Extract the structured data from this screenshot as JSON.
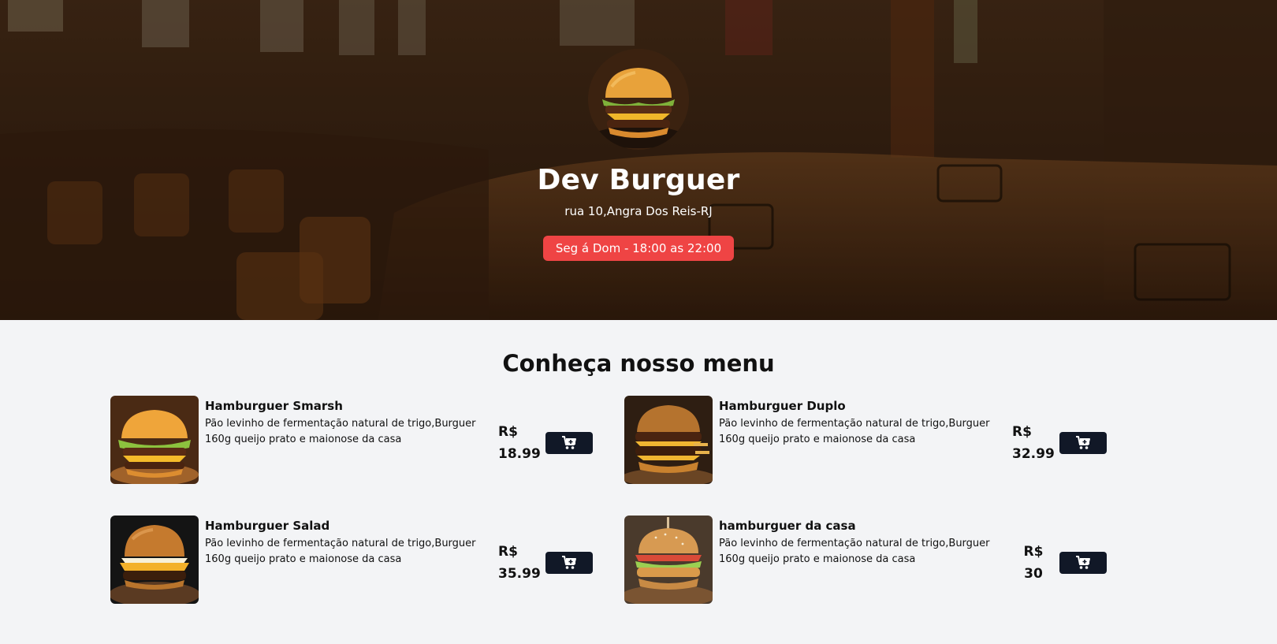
{
  "header": {
    "name": "Dev Burguer",
    "address": "rua 10,Angra Dos Reis-RJ",
    "hours": "Seg á Dom - 18:00 as 22:00",
    "hours_badge_color": "#ef4444"
  },
  "menu": {
    "title": "Conheça nosso menu",
    "items": [
      {
        "name": "Hamburguer Smarsh",
        "description": "Pão levinho de fermentação natural de trigo,Burguer 160g queijo prato e maionose da casa",
        "currency": "R$",
        "price": "18.99",
        "icon": "cart-plus-icon"
      },
      {
        "name": "Hamburguer Duplo",
        "description": "Pão levinho de fermentação natural de trigo,Burguer 160g queijo prato e maionose da casa",
        "currency": "R$",
        "price": "32.99",
        "icon": "cart-plus-icon"
      },
      {
        "name": "Hamburguer Salad",
        "description": "Pão levinho de fermentação natural de trigo,Burguer 160g queijo prato e maionose da casa",
        "currency": "R$",
        "price": "35.99",
        "icon": "cart-plus-icon"
      },
      {
        "name": "hamburguer da casa",
        "description": "Pão levinho de fermentação natural de trigo,Burguer 160g queijo prato e maionose da casa",
        "currency": "R$",
        "price": "30",
        "icon": "cart-plus-icon"
      }
    ]
  },
  "colors": {
    "accent": "#ef4444",
    "button": "#111827",
    "page_background": "#f3f4f6"
  }
}
